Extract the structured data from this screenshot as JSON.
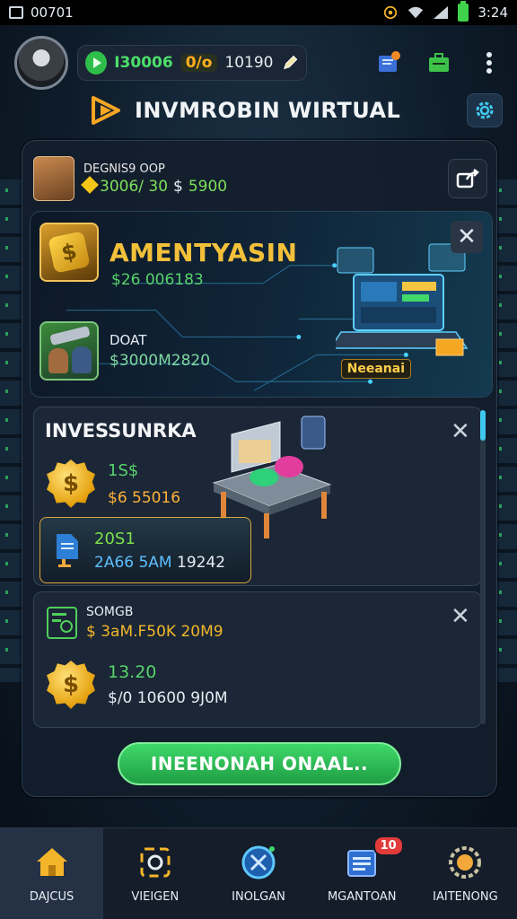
{
  "status_bar": {
    "left_text": "00701",
    "time": "3:24"
  },
  "header": {
    "currency_primary": "I30006",
    "percent_badge": "0/o",
    "currency_secondary": "10190",
    "icons": [
      "quest-book-icon",
      "briefcase-icon",
      "more-vert-icon"
    ]
  },
  "title_bar": {
    "title": "INVMROBIN WIRTUAL"
  },
  "daily_offer": {
    "label": "DEGNIS9 OOP",
    "value_a": "3006/ 30",
    "currency_sign": "$",
    "value_b": "5900"
  },
  "featured": {
    "title": "AMENTYASIN",
    "subtitle": "$26 006183",
    "item_name": "DOAT",
    "item_value": "$3000M2820",
    "tag": "Neeanai",
    "coin_symbol": "$",
    "close_symbol": "✕"
  },
  "invest_card": {
    "title": "INVESSUNRKA",
    "value_a": "1S$",
    "value_b": "$6 55016",
    "doc_value": "20S1",
    "doc_stat_a": "2A66 5AM",
    "doc_stat_b": "19242",
    "coin_symbol": "$",
    "close_symbol": "✕"
  },
  "card2": {
    "label": "SOMGB",
    "value": "$ 3aM.F50K 20M9",
    "amount": "13.20",
    "detail": "$/0 10600 9J0M",
    "coin_symbol": "$",
    "close_symbol": "✕"
  },
  "cta": {
    "label": "INEENONAH ONAAL.."
  },
  "bottom_nav": {
    "items": [
      {
        "label": "DAJCUS",
        "icon": "home-icon",
        "active": true
      },
      {
        "label": "VIEIGEN",
        "icon": "camera-refresh-icon",
        "active": false
      },
      {
        "label": "INOLGAN",
        "icon": "target-cross-icon",
        "active": false
      },
      {
        "label": "MGANTOAN",
        "icon": "document-list-icon",
        "active": false,
        "badge": "10"
      },
      {
        "label": "IAITENONG",
        "icon": "gear-coin-icon",
        "active": false
      }
    ]
  },
  "colors": {
    "accent_green": "#3fd86a",
    "gold": "#f3c03a",
    "panel_bg": "#141e2c",
    "cyan": "#3fc7ee"
  }
}
